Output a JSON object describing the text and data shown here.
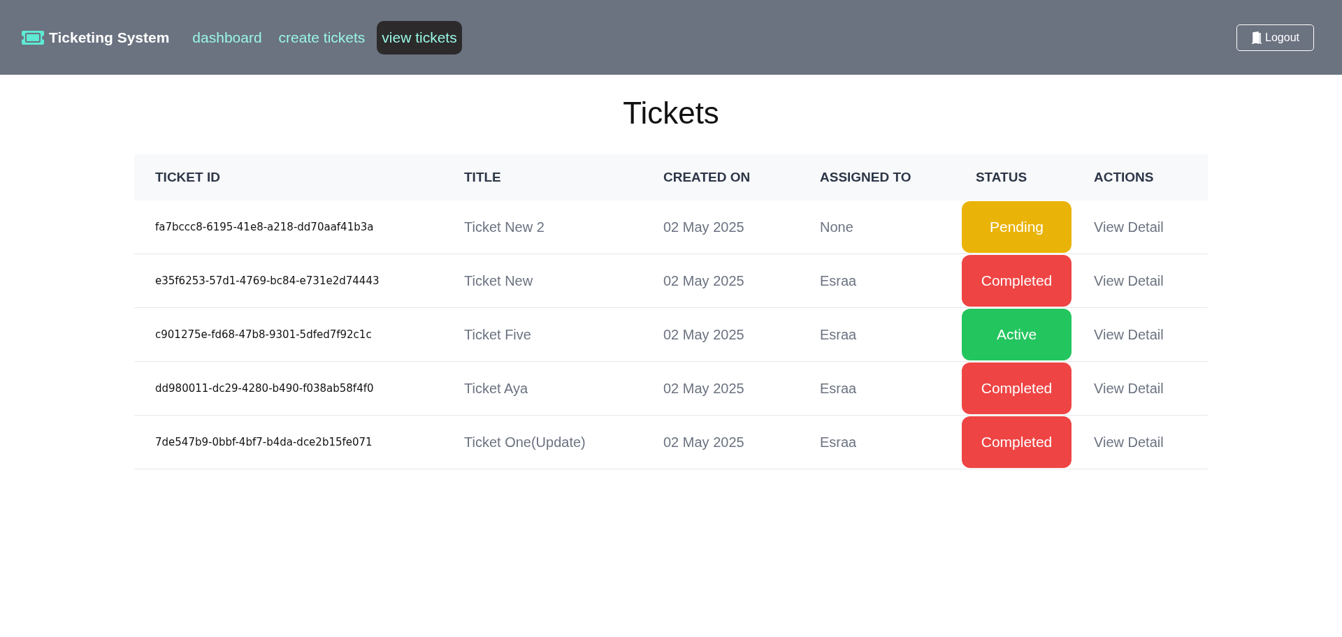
{
  "navbar": {
    "brand": "Ticketing System",
    "links": [
      {
        "label": "dashboard",
        "selected": false
      },
      {
        "label": "create tickets",
        "selected": false
      },
      {
        "label": "view tickets",
        "selected": true
      }
    ],
    "logout": "Logout"
  },
  "page_title": "Tickets",
  "table": {
    "columns": [
      "TICKET ID",
      "TITLE",
      "CREATED ON",
      "ASSIGNED TO",
      "STATUS",
      "ACTIONS"
    ],
    "rows": [
      {
        "ticket_id": "fa7bccc8-6195-41e8-a218-dd70aaf41b3a",
        "title": "Ticket New 2",
        "created_on": "02 May 2025",
        "assigned_to": "None",
        "status": "Pending",
        "color": "#eab308",
        "action": "View Detail"
      },
      {
        "ticket_id": "e35f6253-57d1-4769-bc84-e731e2d74443",
        "title": "Ticket New",
        "created_on": "02 May 2025",
        "assigned_to": "Esraa",
        "status": "Completed",
        "color": "#ef4444",
        "action": "View Detail"
      },
      {
        "ticket_id": "c901275e-fd68-47b8-9301-5dfed7f92c1c",
        "title": "Ticket Five",
        "created_on": "02 May 2025",
        "assigned_to": "Esraa",
        "status": "Active",
        "color": "#22c55e",
        "action": "View Detail"
      },
      {
        "ticket_id": "dd980011-dc29-4280-b490-f038ab58f4f0",
        "title": "Ticket Aya",
        "created_on": "02 May 2025",
        "assigned_to": "Esraa",
        "status": "Completed",
        "color": "#ef4444",
        "action": "View Detail"
      },
      {
        "ticket_id": "7de547b9-0bbf-4bf7-b4da-dce2b15fe071",
        "title": "Ticket One(Update)",
        "created_on": "02 May 2025",
        "assigned_to": "Esraa",
        "status": "Completed",
        "color": "#ef4444",
        "action": "View Detail"
      }
    ]
  }
}
